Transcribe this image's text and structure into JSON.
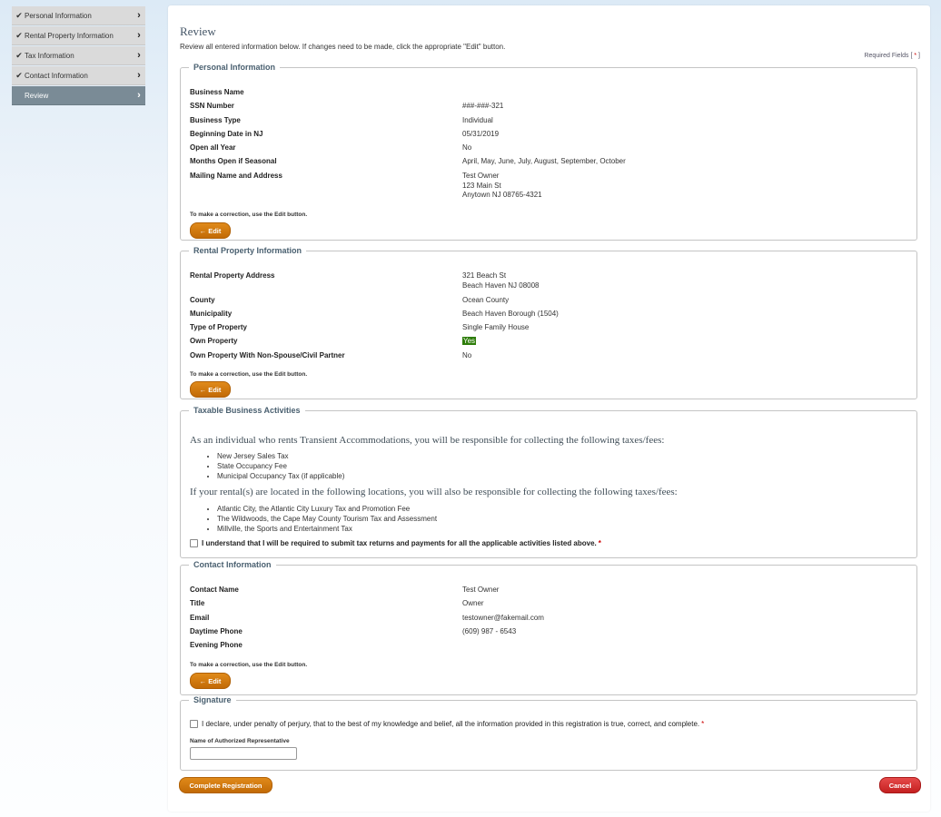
{
  "sidebar": {
    "items": [
      {
        "label": "Personal Information"
      },
      {
        "label": "Rental Property Information"
      },
      {
        "label": "Tax Information"
      },
      {
        "label": "Contact Information"
      },
      {
        "label": "Review"
      }
    ],
    "check_glyph": "✔",
    "chevron_glyph": "›"
  },
  "page": {
    "title": "Review",
    "intro": "Review all entered information below. If changes need to be made, click the appropriate \"Edit\" button.",
    "required_label": "Required Fields [",
    "required_star": "*",
    "required_close": "]"
  },
  "common": {
    "edit_label": "← Edit",
    "correction_hint": "To make a correction, use the Edit button."
  },
  "personal": {
    "legend": "Personal Information",
    "rows": [
      {
        "key": "Business Name",
        "value": ""
      },
      {
        "key": "SSN Number",
        "value": "###-###-321"
      },
      {
        "key": "Business Type",
        "value": "Individual"
      },
      {
        "key": "Beginning Date in NJ",
        "value": "05/31/2019"
      },
      {
        "key": "Open all Year",
        "value": "No"
      },
      {
        "key": "Months Open if Seasonal",
        "value": "April, May, June, July, August, September, October"
      },
      {
        "key": "Mailing Name and Address",
        "lines": [
          "Test Owner",
          "123 Main St",
          "Anytown NJ 08765-4321"
        ]
      }
    ]
  },
  "rental": {
    "legend": "Rental Property Information",
    "rows": [
      {
        "key": "Rental Property Address",
        "lines": [
          "321 Beach St",
          "Beach Haven NJ 08008"
        ]
      },
      {
        "key": "County",
        "value": "Ocean County"
      },
      {
        "key": "Municipality",
        "value": "Beach Haven Borough (1504)"
      },
      {
        "key": "Type of Property",
        "value": "Single Family House"
      },
      {
        "key": "Own Property",
        "value": "Yes"
      },
      {
        "key": "Own Property With Non-Spouse/Civil Partner",
        "value": "No"
      }
    ]
  },
  "taxable": {
    "legend": "Taxable Business Activities",
    "intro1": "As an individual who rents Transient Accommodations, you will be responsible for collecting the following taxes/fees:",
    "list1": [
      "New Jersey Sales Tax",
      "State Occupancy Fee",
      "Municipal Occupancy Tax (if applicable)"
    ],
    "intro2": "If your rental(s) are located in the following locations, you will also be responsible for collecting the following taxes/fees:",
    "list2": [
      "Atlantic City, the Atlantic City Luxury Tax and Promotion Fee",
      "The Wildwoods, the Cape May County Tourism Tax and Assessment",
      "Millville, the Sports and Entertainment Tax"
    ],
    "acknowledge": "I understand that I will be required to submit tax returns and payments for all the applicable activities listed above.",
    "star": "*"
  },
  "contact": {
    "legend": "Contact Information",
    "rows": [
      {
        "key": "Contact Name",
        "value": "Test Owner"
      },
      {
        "key": "Title",
        "value": "Owner"
      },
      {
        "key": "Email",
        "value": "testowner@fakemail.com"
      },
      {
        "key": "Daytime Phone",
        "value": "(609) 987 - 6543"
      },
      {
        "key": "Evening Phone",
        "value": ""
      }
    ]
  },
  "signature": {
    "legend": "Signature",
    "declare": "I declare, under penalty of perjury, that to the best of my knowledge and belief, all the information provided in this registration is true, correct, and complete.",
    "star": "*",
    "rep_label": "Name of Authorized Representative",
    "rep_value": ""
  },
  "actions": {
    "complete_label": "Complete Registration",
    "cancel_label": "Cancel"
  },
  "colors": {
    "accent_orange": "#c26a06",
    "cancel_red": "#c42020",
    "highlight_green": "#2e7d0a",
    "sidebar_active": "#7a8b96"
  }
}
